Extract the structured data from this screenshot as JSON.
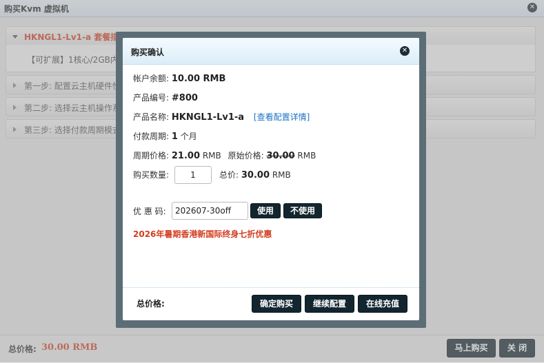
{
  "window": {
    "title": "购买Kvm 虚拟机"
  },
  "panels": [
    {
      "label": "HKNGL1-Lv1-a 套餐描述:",
      "body": "【可扩展】1核心/2GB内存"
    },
    {
      "label": "第一步: 配置云主机硬件性"
    },
    {
      "label": "第二步: 选择云主机操作系"
    },
    {
      "label": "第三步: 选择付款周期模式"
    }
  ],
  "bottom": {
    "total_label": "总价格:",
    "total_value": "30.00 RMB",
    "buy_now": "马上购买",
    "close": "关 闭"
  },
  "modal": {
    "title": "购买确认",
    "balance_label": "帐户余额:",
    "balance_value": "10.00 RMB",
    "product_no_label": "产品编号:",
    "product_no_value": "#800",
    "product_name_label": "产品名称:",
    "product_name_value": "HKNGL1-Lv1-a",
    "config_link": "[查看配置详情]",
    "cycle_label": "付款周期:",
    "cycle_value": "1",
    "cycle_unit": "个月",
    "period_price_label": "周期价格:",
    "period_price_value": "21.00",
    "original_price_label": "原始价格:",
    "original_price_value": "30.00",
    "currency": "RMB",
    "qty_label": "购买数量:",
    "qty_value": "1",
    "sum_label": "总价:",
    "sum_value": "30.00",
    "coupon_label": "优 惠 码:",
    "coupon_value": "202607-30off",
    "use_btn": "使用",
    "nouse_btn": "不使用",
    "promo_text": "2026年暑期香港新国际终身七折优惠",
    "footer_total_label": "总价格:",
    "confirm_btn": "确定购买",
    "continue_btn": "继续配置",
    "recharge_btn": "在线充值"
  },
  "icons": {
    "close": "close-icon",
    "expand": "triangle-down-icon",
    "collapsed": "triangle-right-icon"
  }
}
